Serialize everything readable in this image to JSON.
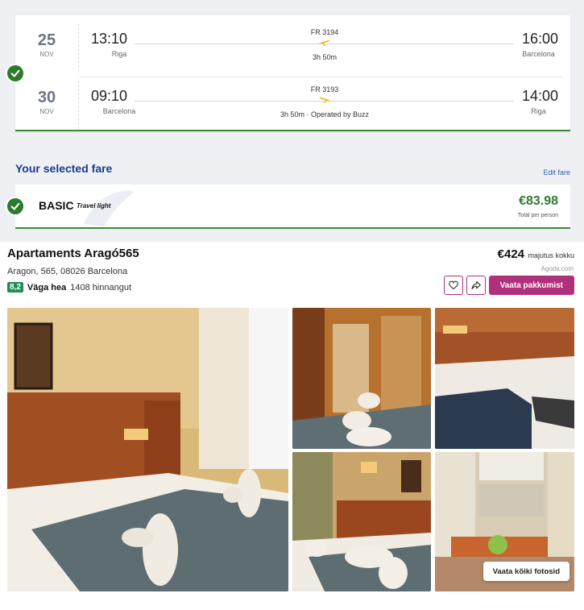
{
  "flights": {
    "outbound": {
      "day": "25",
      "month": "NOV",
      "depart_time": "13:10",
      "depart_city": "Riga",
      "arrive_time": "16:00",
      "arrive_city": "Barcelona",
      "flight_number": "FR 3194",
      "duration": "3h 50m"
    },
    "return": {
      "day": "30",
      "month": "NOV",
      "depart_time": "09:10",
      "depart_city": "Barcelona",
      "arrive_time": "14:00",
      "arrive_city": "Riga",
      "flight_number": "FR 3193",
      "duration": "3h 50m · Operated by Buzz"
    }
  },
  "fare": {
    "section_title": "Your selected fare",
    "edit_label": "Edit fare",
    "name": "BASIC",
    "tagline": "Travel light",
    "price": "€83.98",
    "price_note": "Total per person"
  },
  "hotel": {
    "name": "Apartaments Aragó565",
    "address": "Aragon, 565, 08026 Barcelona",
    "rating_score": "8,2",
    "rating_label": "Väga hea",
    "rating_count": "1408 hinnangut",
    "price": "€424",
    "price_note": "majutus kokku",
    "provider": "Agoda.com",
    "deals_label": "Vaata pakkumist",
    "all_photos_label": "Vaata kõiki fotosid"
  },
  "colors": {
    "accent_green": "#2c7b2c",
    "fare_title_blue": "#1a3a8e",
    "hotel_accent": "#b0307c",
    "rating_green": "#1d8d5a"
  },
  "icons": [
    "check-icon",
    "plane-icon",
    "heart-icon",
    "share-icon"
  ]
}
